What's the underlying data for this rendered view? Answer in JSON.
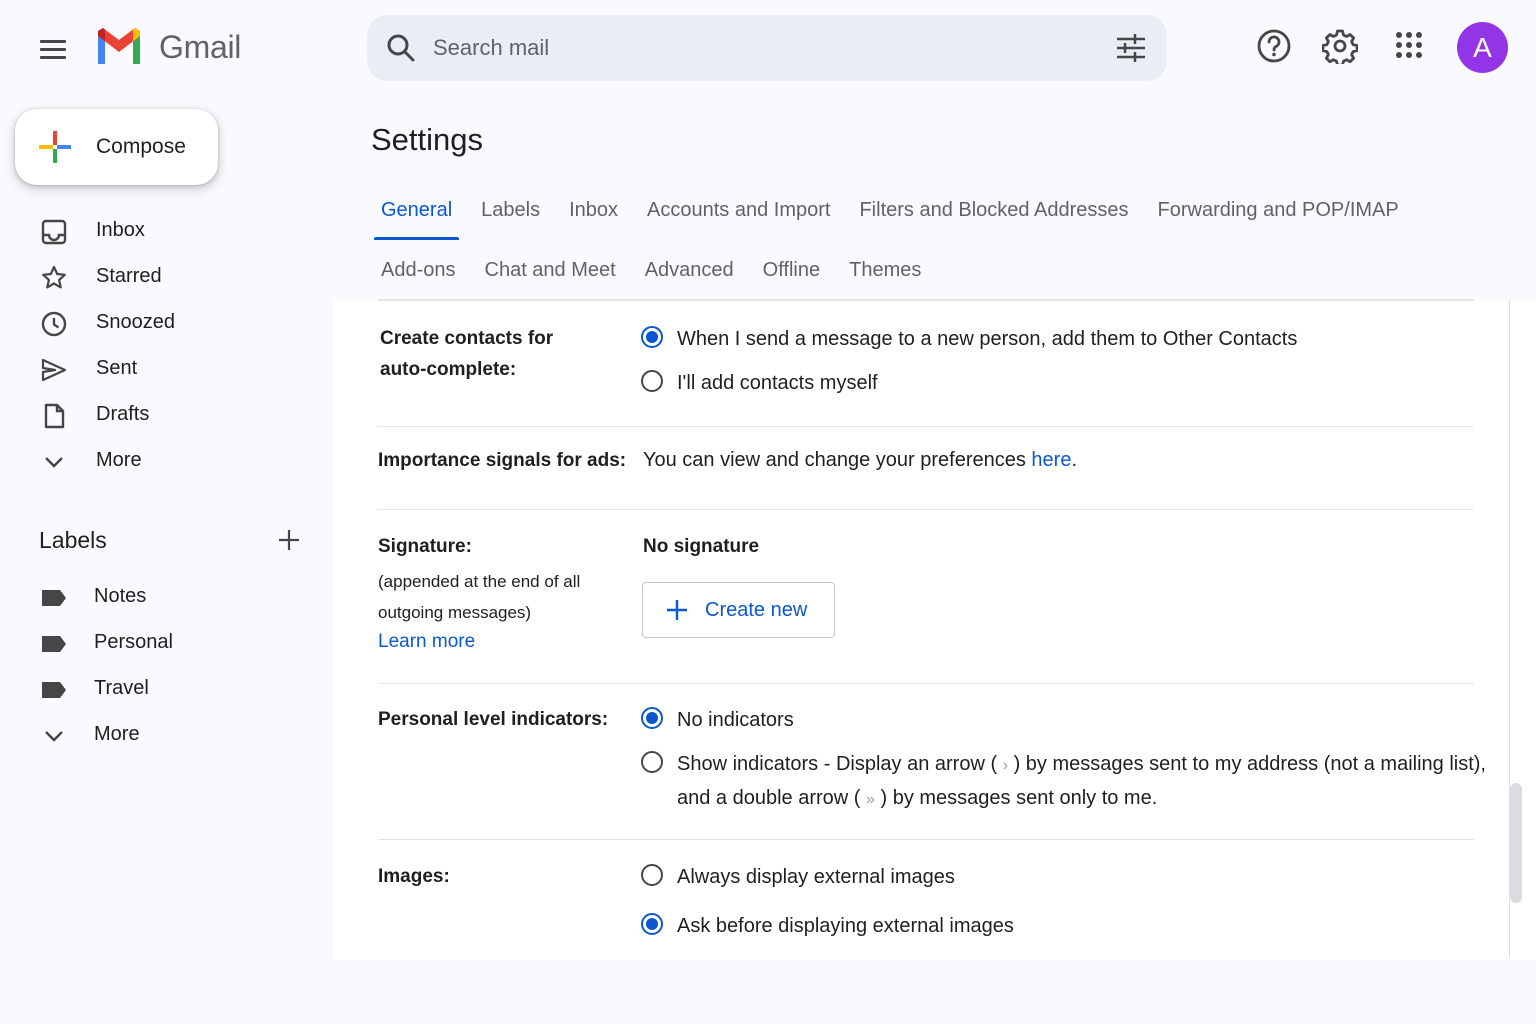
{
  "app": {
    "name": "Gmail"
  },
  "search": {
    "placeholder": "Search mail"
  },
  "avatar": {
    "initial": "A",
    "color": "#9334e6"
  },
  "compose": {
    "label": "Compose"
  },
  "nav": {
    "items": [
      {
        "label": "Inbox",
        "icon": "inbox-icon"
      },
      {
        "label": "Starred",
        "icon": "star-icon"
      },
      {
        "label": "Snoozed",
        "icon": "clock-icon"
      },
      {
        "label": "Sent",
        "icon": "send-icon"
      },
      {
        "label": "Drafts",
        "icon": "file-icon"
      },
      {
        "label": "More",
        "icon": "chevron-down-icon"
      }
    ]
  },
  "labels": {
    "title": "Labels",
    "items": [
      {
        "label": "Notes",
        "icon": "label-icon"
      },
      {
        "label": "Personal",
        "icon": "label-icon"
      },
      {
        "label": "Travel",
        "icon": "label-icon"
      },
      {
        "label": "More",
        "icon": "chevron-down-icon"
      }
    ]
  },
  "settings": {
    "title": "Settings",
    "tabs_row1": [
      "General",
      "Labels",
      "Inbox",
      "Accounts and Import",
      "Filters and Blocked Addresses",
      "Forwarding and POP/IMAP"
    ],
    "tabs_row2": [
      "Add-ons",
      "Chat and Meet",
      "Advanced",
      "Offline",
      "Themes"
    ],
    "active_tab": "General",
    "contacts": {
      "label_line1": "Create contacts for",
      "label_line2": "auto-complete:",
      "option1": "When I send a message to a new person, add them to Other Contacts",
      "option2": "I'll add contacts myself",
      "selected": 1
    },
    "ads": {
      "label": "Importance signals for ads:",
      "text": "You can view and change your preferences",
      "link": "here",
      "suffix": "."
    },
    "signature": {
      "label": "Signature:",
      "sub": "(appended at the end of all outgoing messages)",
      "learn_more": "Learn more",
      "value": "No signature",
      "create_label": "Create new"
    },
    "indicators": {
      "label": "Personal level indicators:",
      "option1": "No indicators",
      "option2_a": "Show indicators - Display an arrow (",
      "arrow_single": "›",
      "option2_b": ") by messages sent to my address (not a mailing list),",
      "option2_c": "and a double arrow (",
      "arrow_double": "»",
      "option2_d": ") by messages sent only to me.",
      "selected": 1
    },
    "images": {
      "label": "Images:",
      "option1": "Always display external images",
      "option2": "Ask before displaying external images",
      "selected": 2
    }
  },
  "colors": {
    "accent": "#0b57d0",
    "background": "#f8fafd"
  }
}
